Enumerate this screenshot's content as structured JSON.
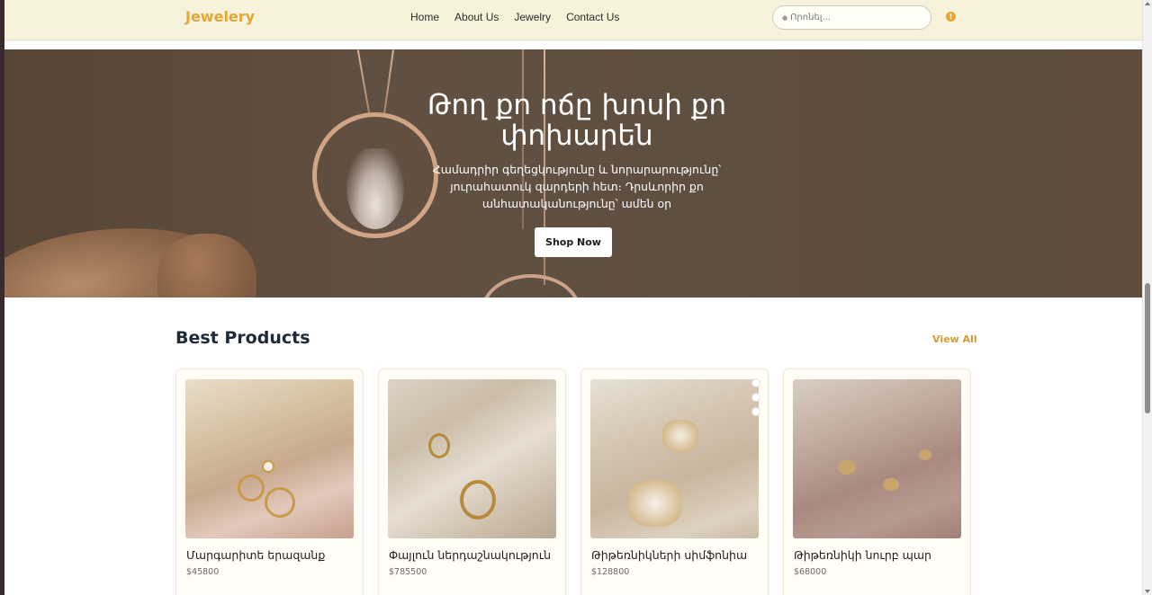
{
  "brand": {
    "name": "Jewelery",
    "accent": "#e2a63a"
  },
  "nav": {
    "items": [
      "Home",
      "About Us",
      "Jewelry",
      "Contact Us"
    ]
  },
  "search": {
    "placeholder": "Որոնել..."
  },
  "hero": {
    "title": "Թող քո ոճը խոսի քո փոխարեն",
    "subtitle": "Համադրիր գեղեցկությունը և նորարարությունը՝ յուրահատուկ զարդերի հետ։ Դրսևորիր քո անհատականությունը՝ ամեն օր",
    "cta": "Shop Now"
  },
  "products": {
    "title": "Best Products",
    "view_all": "View All",
    "items": [
      {
        "name": "Մարգարիտե երազանք",
        "price": "$45800"
      },
      {
        "name": "Փայլուն ներդաշնակություն",
        "price": "$785500"
      },
      {
        "name": "Թիթեռնիկների սիմֆոնիա",
        "price": "$128800"
      },
      {
        "name": "Թիթեռնիկի նուրբ պար",
        "price": "$68000"
      }
    ]
  }
}
